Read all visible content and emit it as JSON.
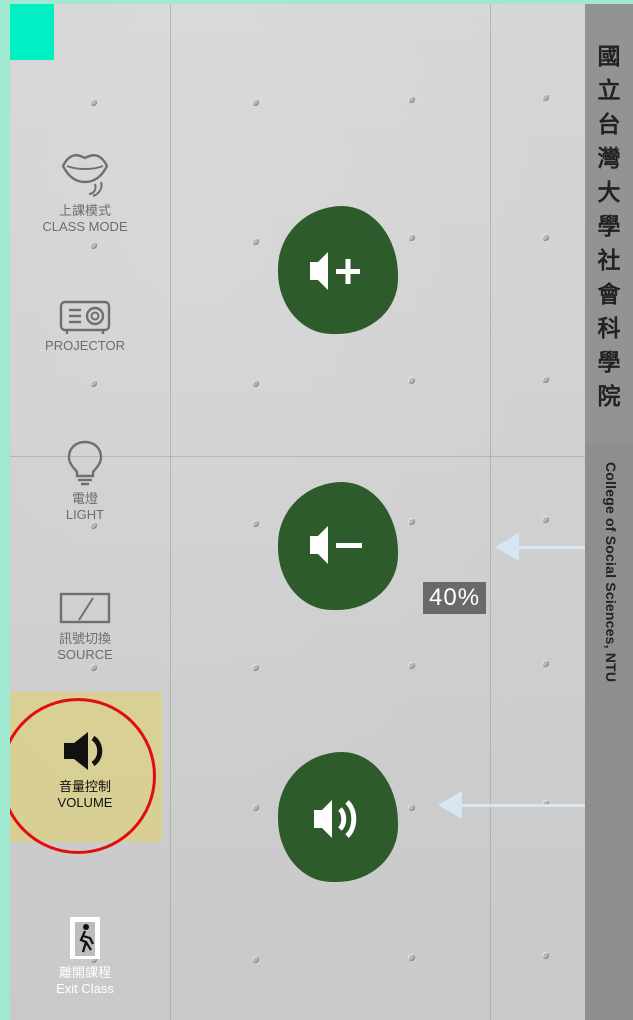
{
  "banner": {
    "chinese": "國立台灣大學　社會科學院",
    "english": "College of Social Sciences, NTU"
  },
  "sidebar": {
    "items": [
      {
        "cn": "上課模式",
        "en": "CLASS MODE",
        "icon": "lips-icon",
        "active": false
      },
      {
        "cn": "",
        "en": "PROJECTOR",
        "icon": "projector-icon",
        "active": false
      },
      {
        "cn": "電燈",
        "en": "LIGHT",
        "icon": "lightbulb-icon",
        "active": false
      },
      {
        "cn": "訊號切換",
        "en": "SOURCE",
        "icon": "source-switch-icon",
        "active": false
      },
      {
        "cn": "音量控制",
        "en": "VOLUME",
        "icon": "speaker-icon",
        "active": true
      },
      {
        "cn": "離開課程",
        "en": "Exit Class",
        "icon": "exit-door-icon",
        "active": false
      }
    ]
  },
  "volume": {
    "buttons": [
      {
        "icon": "volume-up-icon"
      },
      {
        "icon": "volume-down-icon"
      },
      {
        "icon": "volume-mute-toggle-icon"
      }
    ],
    "level": "40%"
  },
  "colors": {
    "button_green": "#2e5b2b",
    "active_highlight": "#e6d250",
    "annotation_red": "#e40d0d",
    "arrow_blue": "#d7e6f2",
    "teal": "#00f0c4"
  }
}
